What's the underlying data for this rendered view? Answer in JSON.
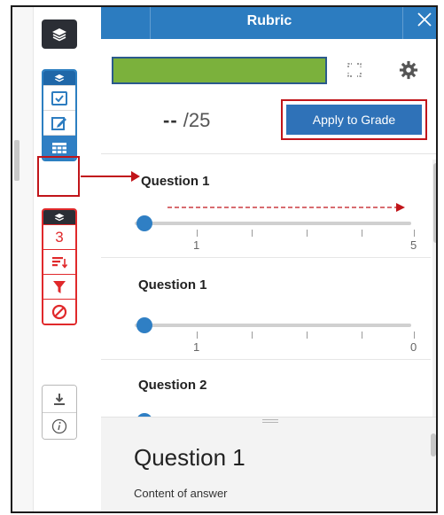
{
  "header": {
    "title": "Rubric",
    "close_icon": "close-icon"
  },
  "score": {
    "current": "--",
    "total": "/25"
  },
  "apply_button": {
    "label": "Apply to Grade"
  },
  "toolbar": {
    "top_icon": "layers-icon",
    "blue_group": [
      "layers-icon",
      "checkbox-icon",
      "edit-icon",
      "grid-icon"
    ],
    "red_group": [
      "layers-icon",
      "3",
      "sort-icon",
      "filter-icon",
      "block-icon"
    ],
    "gray_group": [
      "download-icon",
      "info-icon"
    ]
  },
  "questions": [
    {
      "title": "Question 1",
      "min_label": "1",
      "max_label": "5",
      "value": 0
    },
    {
      "title": "Question 1",
      "min_label": "1",
      "max_label": "0",
      "value": 0
    },
    {
      "title": "Question 2"
    }
  ],
  "detail": {
    "title": "Question 1",
    "text": "Content of answer"
  },
  "colors": {
    "header": "#2c7cc0",
    "green_bar": "#7bb13c",
    "highlight": "#c1151a",
    "red_group": "#e0292b"
  }
}
